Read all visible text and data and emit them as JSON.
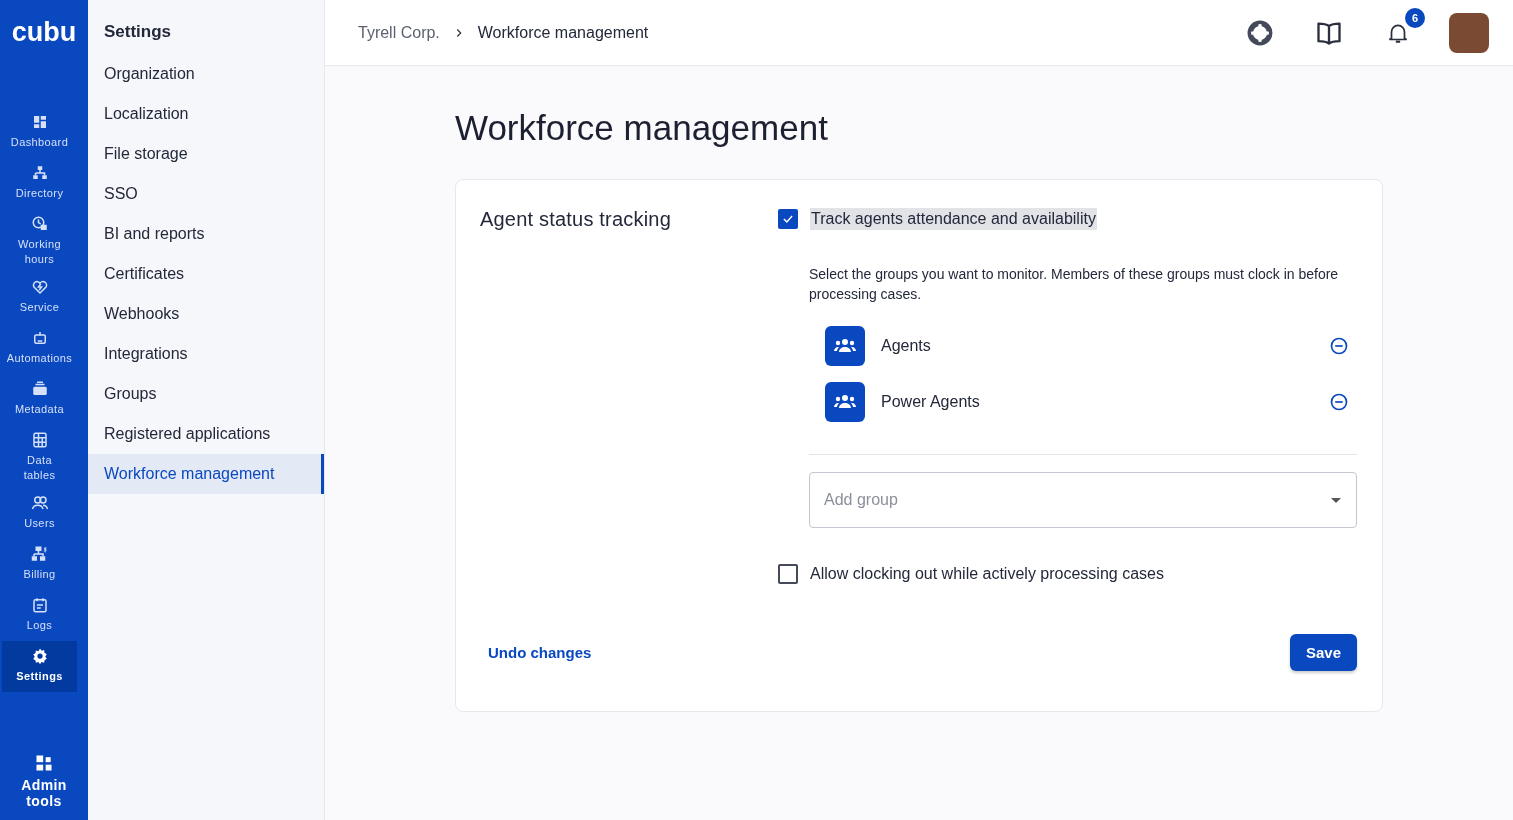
{
  "rail": {
    "logo": "cubu",
    "items": [
      {
        "kind": "dashboard",
        "label": "Dashboard",
        "selected": false
      },
      {
        "kind": "directory",
        "label": "Directory",
        "selected": false
      },
      {
        "kind": "clock",
        "label": "Working hours",
        "selected": false
      },
      {
        "kind": "heart",
        "label": "Service",
        "selected": false
      },
      {
        "kind": "robot",
        "label": "Automations",
        "selected": false
      },
      {
        "kind": "tray",
        "label": "Metadata",
        "selected": false
      },
      {
        "kind": "table",
        "label": "Data tables",
        "selected": false
      },
      {
        "kind": "users",
        "label": "Users",
        "selected": false
      },
      {
        "kind": "billing",
        "label": "Billing",
        "selected": false
      },
      {
        "kind": "calendar",
        "label": "Logs",
        "selected": false
      },
      {
        "kind": "gear",
        "label": "Settings",
        "selected": true
      }
    ],
    "admin": "Admin tools"
  },
  "settings_nav": {
    "title": "Settings",
    "items": [
      {
        "label": "Organization",
        "selected": false
      },
      {
        "label": "Localization",
        "selected": false
      },
      {
        "label": "File storage",
        "selected": false
      },
      {
        "label": "SSO",
        "selected": false
      },
      {
        "label": "BI and reports",
        "selected": false
      },
      {
        "label": "Certificates",
        "selected": false
      },
      {
        "label": "Webhooks",
        "selected": false
      },
      {
        "label": "Integrations",
        "selected": false
      },
      {
        "label": "Groups",
        "selected": false
      },
      {
        "label": "Registered applications",
        "selected": false
      },
      {
        "label": "Workforce management",
        "selected": true
      }
    ]
  },
  "breadcrumb": [
    "Tyrell Corp.",
    "Workforce management"
  ],
  "notifications": {
    "count": "6"
  },
  "page_title": "Workforce management",
  "card": {
    "title": "Agent status tracking",
    "track": {
      "label": "Track agents attendance and availability",
      "checked": true
    },
    "description": "Select the groups you want to monitor. Members of these groups must clock in before processing cases.",
    "groups": [
      {
        "name": "Agents"
      },
      {
        "name": "Power Agents"
      }
    ],
    "add_group": {
      "placeholder": "Add group"
    },
    "allow_clock_out": {
      "label": "Allow clocking out while actively processing cases",
      "checked": false
    },
    "undo": "Undo changes",
    "save": "Save"
  }
}
